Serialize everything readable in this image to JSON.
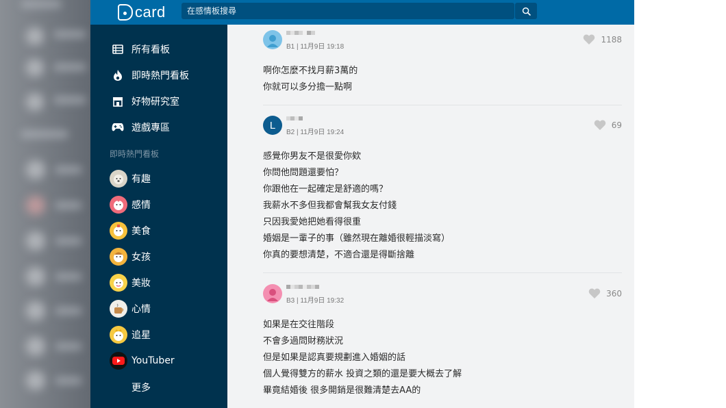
{
  "header": {
    "logo_text": "card",
    "search_placeholder": "在感情板搜尋"
  },
  "sidebar": {
    "nav": [
      {
        "label": "所有看板",
        "icon": "list-icon"
      },
      {
        "label": "即時熱門看板",
        "icon": "fire-icon"
      },
      {
        "label": "好物研究室",
        "icon": "store-icon"
      },
      {
        "label": "遊戲專區",
        "icon": "gamepad-icon"
      }
    ],
    "section_heading": "即時熱門看板",
    "boards": [
      {
        "label": "有趣",
        "icon": "dog-avatar-icon"
      },
      {
        "label": "感情",
        "icon": "heart-avatar-icon"
      },
      {
        "label": "美食",
        "icon": "food-avatar-icon"
      },
      {
        "label": "女孩",
        "icon": "girl-avatar-icon"
      },
      {
        "label": "美妝",
        "icon": "makeup-avatar-icon"
      },
      {
        "label": "心情",
        "icon": "mood-avatar-icon"
      },
      {
        "label": "追星",
        "icon": "star-avatar-icon"
      },
      {
        "label": "YouTuber",
        "icon": "youtube-icon"
      }
    ],
    "more_label": "更多"
  },
  "comments": [
    {
      "floor_meta": "B1 | 11月9日 19:18",
      "likes": "1188",
      "avatar_color": "#7ec3e8",
      "avatar_letter": "",
      "lines": [
        "啊你怎麼不找月薪3萬的",
        "你就可以多分擔一點啊"
      ]
    },
    {
      "floor_meta": "B2 | 11月9日 19:24",
      "likes": "69",
      "avatar_color": "#0d5c8f",
      "avatar_letter": "L",
      "lines": [
        "感覺你男友不是很愛你欸",
        "你問他問題還要怕？",
        "你跟他在一起確定是舒適的嗎？",
        "我薪水不多但我都會幫我女友付錢",
        "只因我愛她把她看得很重",
        "婚姻是一輩子的事（雖然現在離婚很輕描淡寫）",
        "你真的要想清楚，不適合還是得斷捨離"
      ]
    },
    {
      "floor_meta": "B3 | 11月9日 19:32",
      "likes": "360",
      "avatar_color": "#f48fb1",
      "avatar_letter": "",
      "lines": [
        "如果是在交往階段",
        "不會多過問財務狀況",
        "但是如果是認真要規劃進入婚姻的話",
        "個人覺得雙方的薪水 投資之類的還是要大概去了解",
        "畢竟結婚後 很多開銷是很難清楚去AA的"
      ]
    }
  ]
}
